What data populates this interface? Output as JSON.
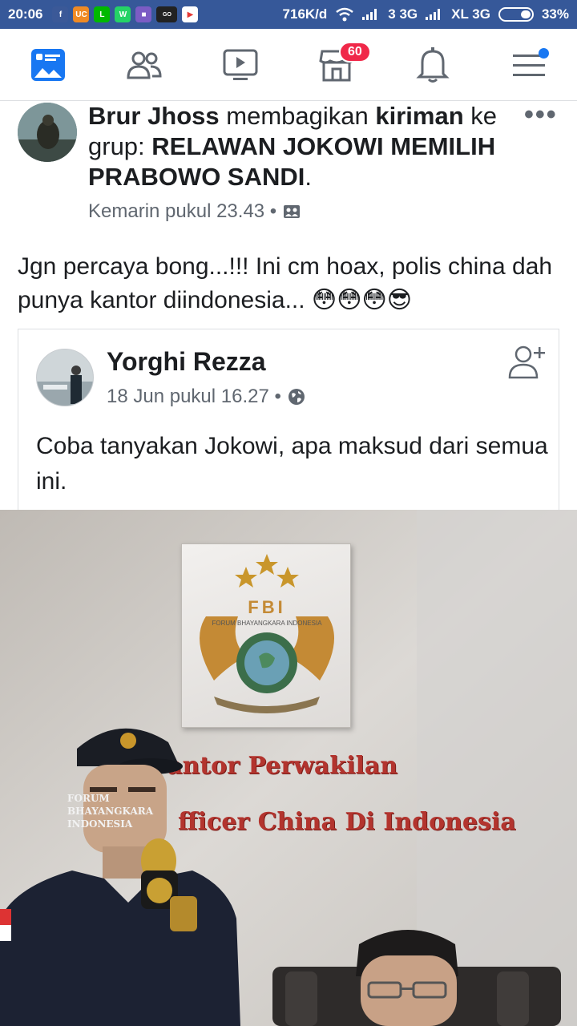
{
  "status_bar": {
    "time": "20:06",
    "network_speed": "716K/d",
    "carrier1": "3 3G",
    "carrier2": "XL 3G",
    "battery": "33%",
    "app_icons": [
      "facebook-icon",
      "uc-browser-icon",
      "line-icon",
      "whatsapp-icon",
      "app-icon",
      "gojek-icon",
      "play-store-icon"
    ]
  },
  "navbar": {
    "items": [
      "news-feed-icon",
      "friends-icon",
      "watch-icon",
      "marketplace-icon",
      "notifications-icon",
      "menu-icon"
    ],
    "marketplace_badge": "60"
  },
  "post": {
    "author": "Brur Jhoss",
    "action_text": " membagikan ",
    "object_text": "kiriman",
    "group_prefix": " ke grup: ",
    "group_name": "RELAWAN JOKOWI MEMILIH PRABOWO SANDI",
    "period": ".",
    "timestamp": "Kemarin pukul 23.43 •",
    "body": "Jgn percaya bong...!!! Ini cm hoax, polis china dah punya kantor diindonesia... 😳😳😳😎"
  },
  "shared_post": {
    "author": "Yorghi Rezza",
    "timestamp": "18 Jun pukul 16.27 •",
    "body": "Coba tanyakan Jokowi, apa maksud dari semua ini."
  },
  "photo": {
    "plaque_title": "FBI",
    "plaque_subtitle": "FORUM BHAYANGKARA INDONESIA",
    "wall_line1": "antor  Perwakilan",
    "wall_line2": "fficer China Di Indonesia",
    "shirt_text": "FORUM BHAYANGKARA INDONESIA"
  },
  "colors": {
    "status_bar": "#365899",
    "nav_icon": "#606770",
    "badge": "#f02849",
    "notification_dot": "#1877f2",
    "wall_text": "#b3342e"
  }
}
